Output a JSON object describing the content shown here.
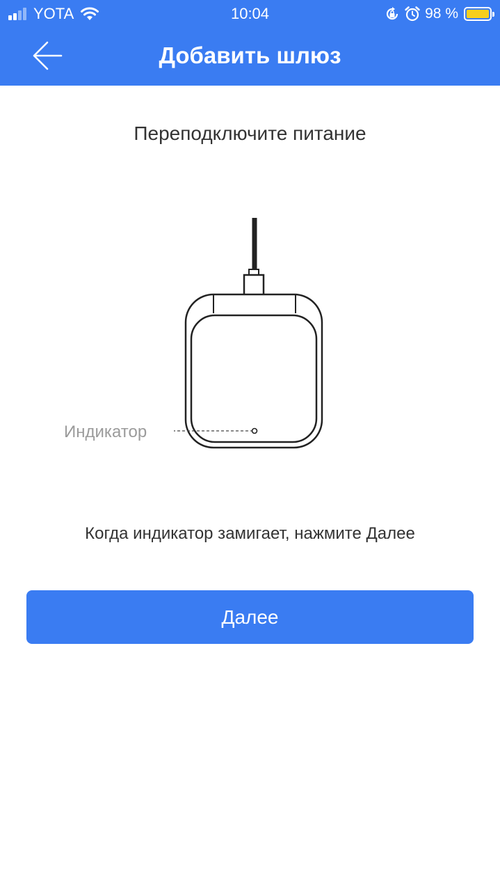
{
  "status_bar": {
    "carrier": "YOTA",
    "time": "10:04",
    "battery_percent": "98 %",
    "signal_bars": 4,
    "signal_bars_active": 2,
    "battery_color": "#f7cf1c",
    "icons": [
      "signal-icon",
      "wifi-icon",
      "orientation-lock-icon",
      "alarm-icon",
      "battery-icon"
    ]
  },
  "header": {
    "title": "Добавить шлюз",
    "back_icon": "arrow-left-icon",
    "background_color": "#3a7cf2"
  },
  "main": {
    "heading": "Переподключите питание",
    "indicator_label": "Индикатор",
    "instruction": "Когда индикатор замигает, нажмите Далее",
    "next_button_label": "Далее",
    "accent_color": "#3a7cf2"
  }
}
